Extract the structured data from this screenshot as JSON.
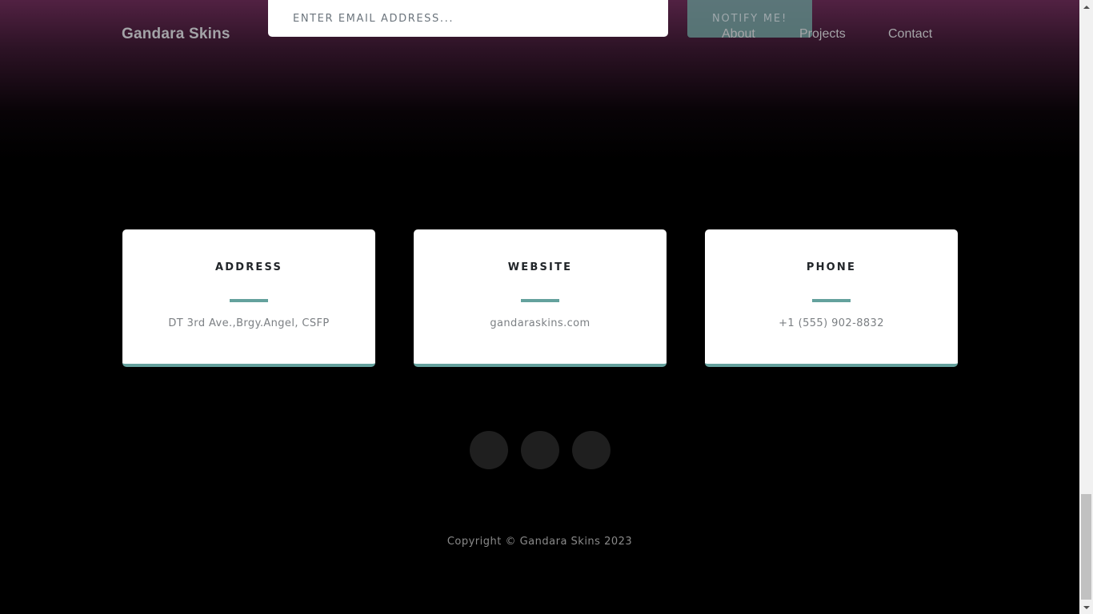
{
  "header": {
    "brand": "Gandara Skins",
    "nav": {
      "about": "About",
      "projects": "Projects",
      "contact": "Contact"
    }
  },
  "signup": {
    "email_placeholder": "ENTER EMAIL ADDRESS...",
    "email_value": "",
    "notify_label": "NOTIFY ME!"
  },
  "contact_cards": {
    "address": {
      "title": "ADDRESS",
      "value": "DT 3rd Ave.,Brgy.Angel, CSFP",
      "icon": "map-marked-icon"
    },
    "website": {
      "title": "WEBSITE",
      "value": "gandaraskins.com",
      "icon": "envelope-icon"
    },
    "phone": {
      "title": "PHONE",
      "value": "+1 (555) 902-8832",
      "icon": "mobile-icon"
    }
  },
  "social": [
    {
      "icon": "twitter-icon"
    },
    {
      "icon": "facebook-icon"
    },
    {
      "icon": "github-icon"
    }
  ],
  "footer": {
    "copyright": "Copyright © Gandara Skins 2023"
  },
  "colors": {
    "accent": "#64a19d",
    "background": "#000000",
    "gradient_top": "#562346",
    "card_bg": "#ffffff",
    "social_bg": "#1f1f1f"
  }
}
